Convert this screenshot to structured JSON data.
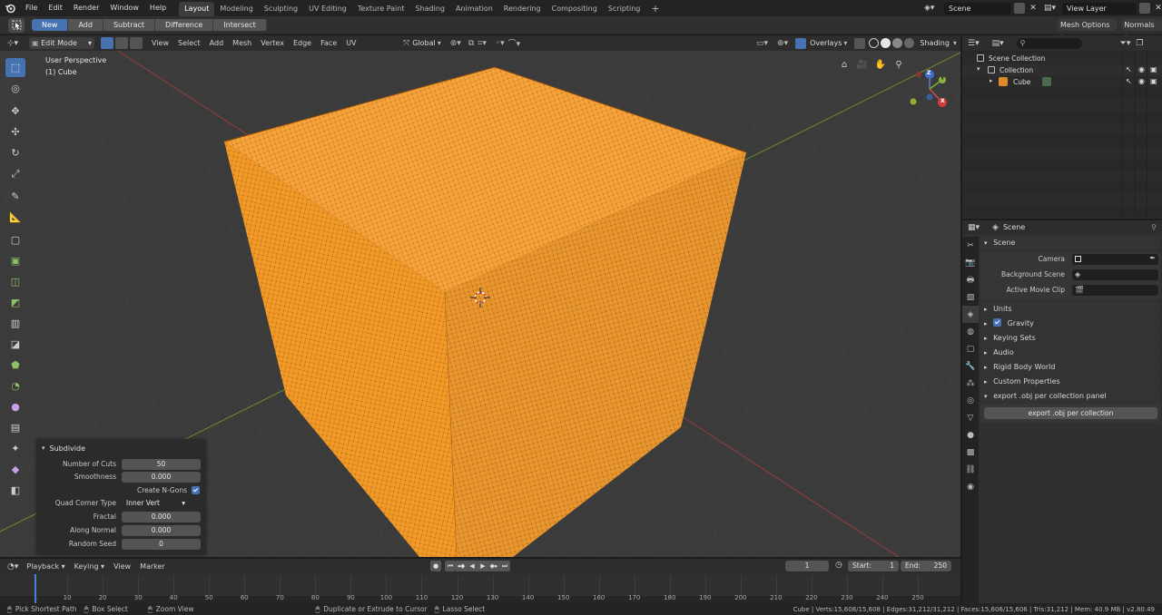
{
  "topbar": {
    "menus": [
      "File",
      "Edit",
      "Render",
      "Window",
      "Help"
    ],
    "workspaces": [
      "Layout",
      "Modeling",
      "Sculpting",
      "UV Editing",
      "Texture Paint",
      "Shading",
      "Animation",
      "Rendering",
      "Compositing",
      "Scripting"
    ],
    "active_workspace": "Layout",
    "add_tab": "+",
    "scene": "Scene",
    "view_layer": "View Layer"
  },
  "tool_settings": {
    "modes": [
      "New",
      "Add",
      "Subtract",
      "Difference",
      "Intersect"
    ],
    "active_mode": "New",
    "mesh_options": "Mesh Options",
    "normals": "Normals"
  },
  "viewport_header": {
    "mode": "Edit Mode",
    "menus": [
      "View",
      "Select",
      "Add",
      "Mesh",
      "Vertex",
      "Edge",
      "Face",
      "UV"
    ],
    "orientation": "Global",
    "overlays": "Overlays",
    "shading": "Shading"
  },
  "viewport": {
    "view_name": "User Perspective",
    "object_name": "(1) Cube",
    "mesh_color": "#f5a02e",
    "gizmo": {
      "x": "X",
      "y": "Y",
      "z": "Z"
    }
  },
  "redo_panel": {
    "title": "Subdivide",
    "number_of_cuts_label": "Number of Cuts",
    "number_of_cuts": "50",
    "smoothness_label": "Smoothness",
    "smoothness": "0.000",
    "create_ngons_label": "Create N-Gons",
    "create_ngons": true,
    "quad_corner_label": "Quad Corner Type",
    "quad_corner": "Inner Vert",
    "fractal_label": "Fractal",
    "fractal": "0.000",
    "along_normal_label": "Along Normal",
    "along_normal": "0.000",
    "random_seed_label": "Random Seed",
    "random_seed": "0"
  },
  "outliner": {
    "scene_collection": "Scene Collection",
    "collection": "Collection",
    "object": "Cube"
  },
  "properties": {
    "context": "Scene",
    "section": "Scene",
    "camera_label": "Camera",
    "background_scene_label": "Background Scene",
    "active_movie_clip_label": "Active Movie Clip",
    "panels": [
      "Units",
      "Gravity",
      "Keying Sets",
      "Audio",
      "Rigid Body World",
      "Custom Properties",
      "export .obj per collection panel"
    ],
    "export_button": "export .obj per collection"
  },
  "timeline": {
    "menus": [
      "Playback",
      "Keying",
      "View",
      "Marker"
    ],
    "current_frame": "1",
    "start_label": "Start:",
    "start": "1",
    "end_label": "End:",
    "end": "250",
    "ticks": [
      "1",
      "10",
      "20",
      "30",
      "40",
      "50",
      "60",
      "70",
      "80",
      "90",
      "100",
      "110",
      "120",
      "130",
      "140",
      "150",
      "160",
      "170",
      "180",
      "190",
      "200",
      "210",
      "220",
      "230",
      "240",
      "250"
    ]
  },
  "statusbar": {
    "hint1": "Pick Shortest Path",
    "hint2": "Box Select",
    "hint3": "Zoom View",
    "hint4": "Duplicate or Extrude to Cursor",
    "hint5": "Lasso Select",
    "stats": "Cube | Verts:15,608/15,608 | Edges:31,212/31,212 | Faces:15,606/15,606 | Tris:31,212 | Mem: 40.9 MB | v2.80.49"
  }
}
